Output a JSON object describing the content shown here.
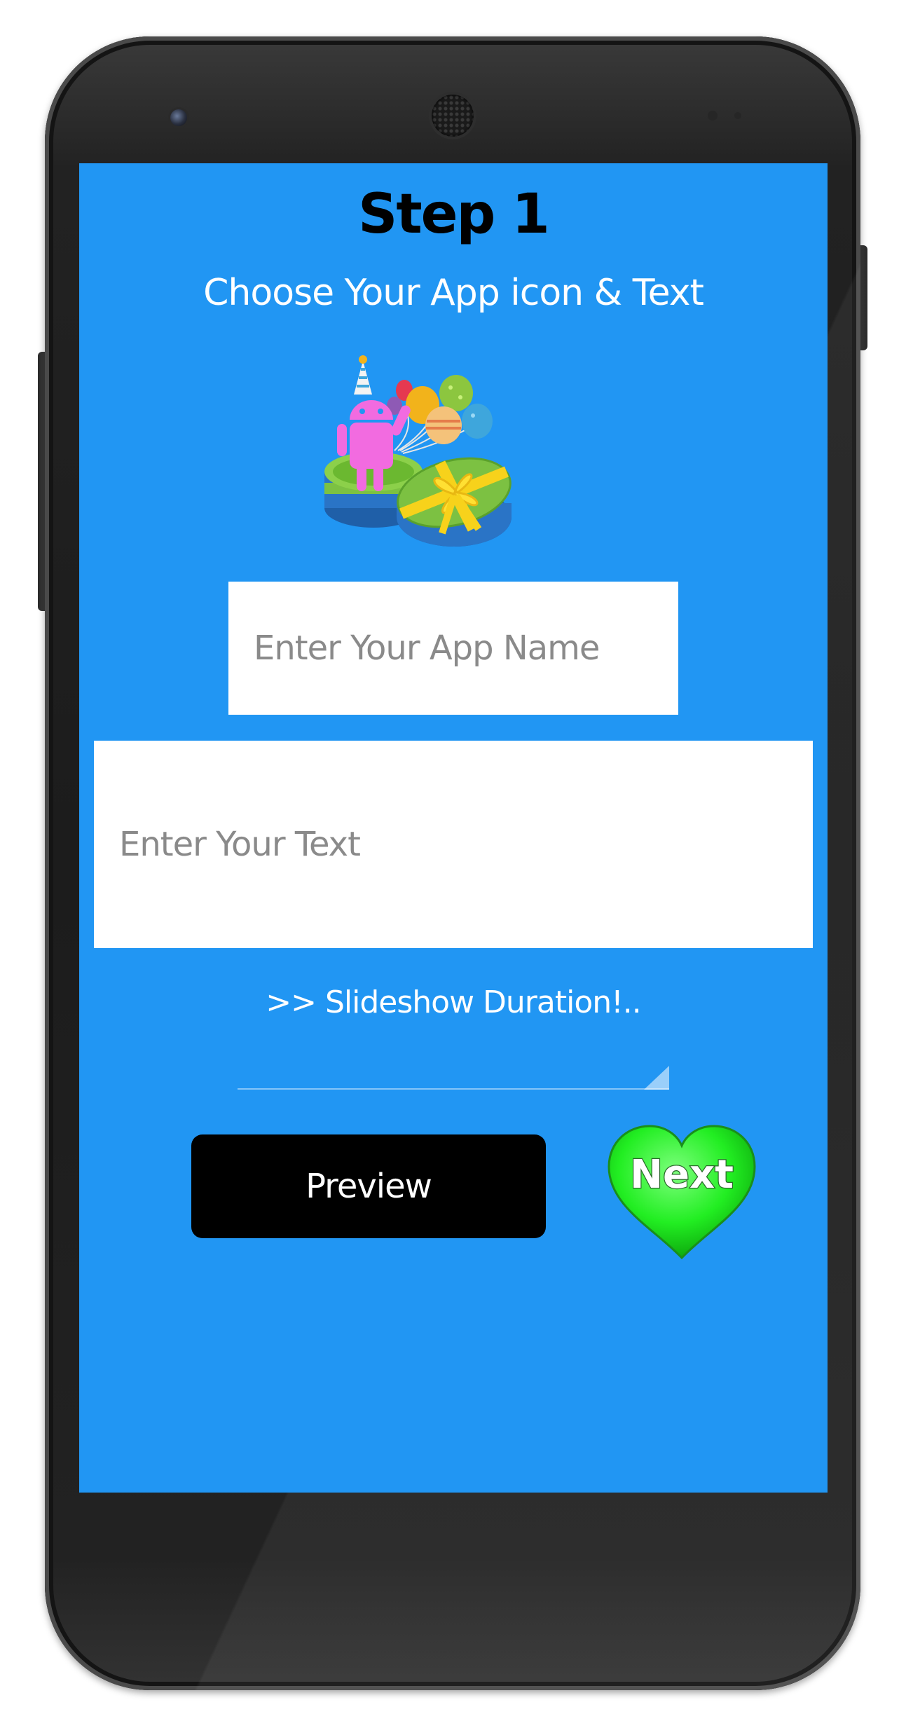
{
  "header": {
    "title": "Step 1",
    "subtitle": "Choose Your App icon & Text"
  },
  "form": {
    "app_name_placeholder": "Enter Your App Name",
    "app_name_value": "",
    "text_placeholder": "Enter Your Text",
    "text_value": ""
  },
  "slideshow": {
    "selected_label": ">> Slideshow Duration!.."
  },
  "buttons": {
    "preview_label": "Preview",
    "next_label": "Next"
  },
  "icons": {
    "app_icon": "android-birthday-gift-icon",
    "spinner_arrow": "dropdown-corner-icon",
    "next_shape": "green-heart-icon"
  },
  "colors": {
    "screen_background": "#2196f3",
    "preview_button": "#000000",
    "next_heart": "#22ee22"
  }
}
